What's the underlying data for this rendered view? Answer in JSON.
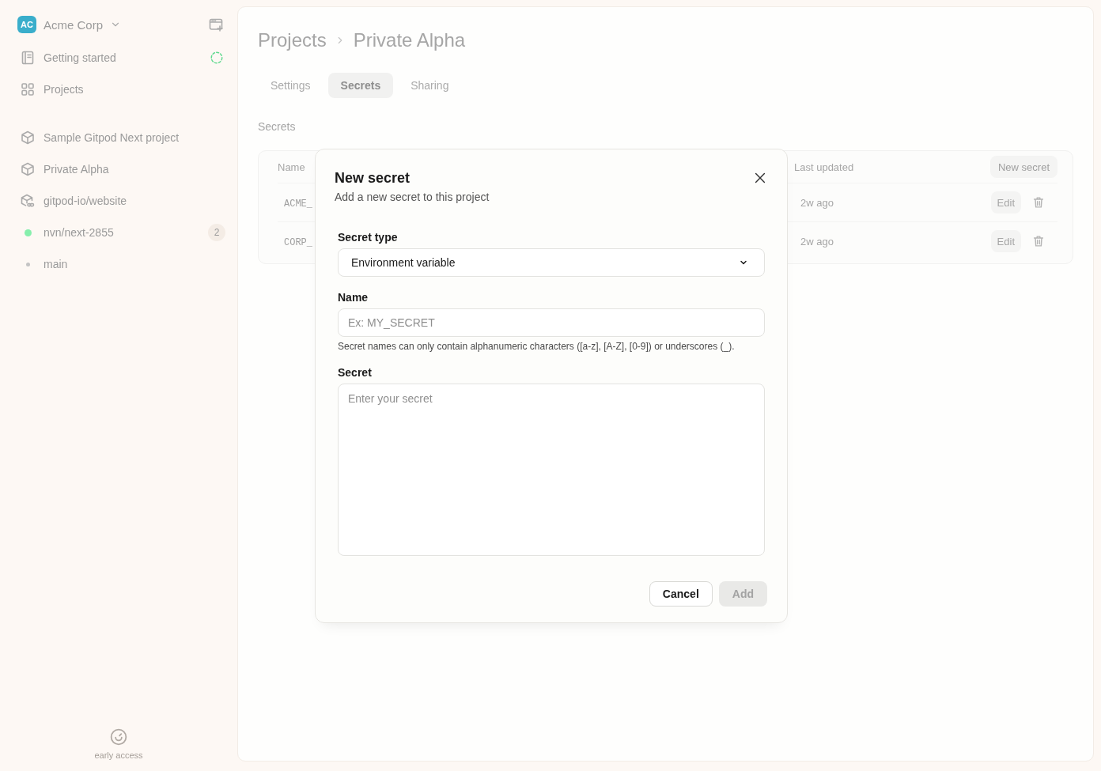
{
  "sidebar": {
    "org": {
      "initials": "AC",
      "name": "Acme Corp"
    },
    "nav": [
      {
        "label": "Getting started",
        "kind": "guide",
        "in_progress": true
      },
      {
        "label": "Projects",
        "kind": "projects",
        "in_progress": false
      }
    ],
    "projects": [
      {
        "label": "Sample Gitpod Next project",
        "kind": "project"
      },
      {
        "label": "Private Alpha",
        "kind": "project"
      },
      {
        "label": "gitpod-io/website",
        "kind": "repository"
      },
      {
        "label": "nvn/next-2855",
        "kind": "environment",
        "color": "#86efac",
        "badge": "2"
      },
      {
        "label": "main",
        "kind": "branch",
        "color": "#c4c4c4"
      }
    ],
    "footer": {
      "label": "early access"
    }
  },
  "header": {
    "breadcrumb": [
      "Projects",
      "Private Alpha"
    ]
  },
  "tabs": [
    {
      "label": "Settings",
      "selected": false
    },
    {
      "label": "Secrets",
      "selected": true
    },
    {
      "label": "Sharing",
      "selected": false
    }
  ],
  "section_title": "Secrets",
  "table": {
    "columns": [
      "Name",
      "Last updated"
    ],
    "new_button": "New secret",
    "rows": [
      {
        "name": "ACME_",
        "updated": "2w ago",
        "edit": "Edit"
      },
      {
        "name": "CORP_",
        "updated": "2w ago",
        "edit": "Edit"
      }
    ]
  },
  "dialog": {
    "title": "New secret",
    "subtitle": "Add a new secret to this project",
    "fields": [
      {
        "kind": "select",
        "label": "Secret type",
        "value": "Environment variable"
      },
      {
        "kind": "input",
        "label": "Name",
        "placeholder": "Ex: MY_SECRET",
        "hint": "Secret names can only contain alphanumeric characters ([a-z], [A-Z], [0-9]) or underscores (_)."
      },
      {
        "kind": "textarea",
        "label": "Secret",
        "placeholder": "Enter your secret"
      }
    ],
    "buttons": [
      {
        "label": "Cancel",
        "kind": "secondary",
        "disabled": false
      },
      {
        "label": "Add",
        "kind": "primary",
        "disabled": true
      }
    ]
  }
}
